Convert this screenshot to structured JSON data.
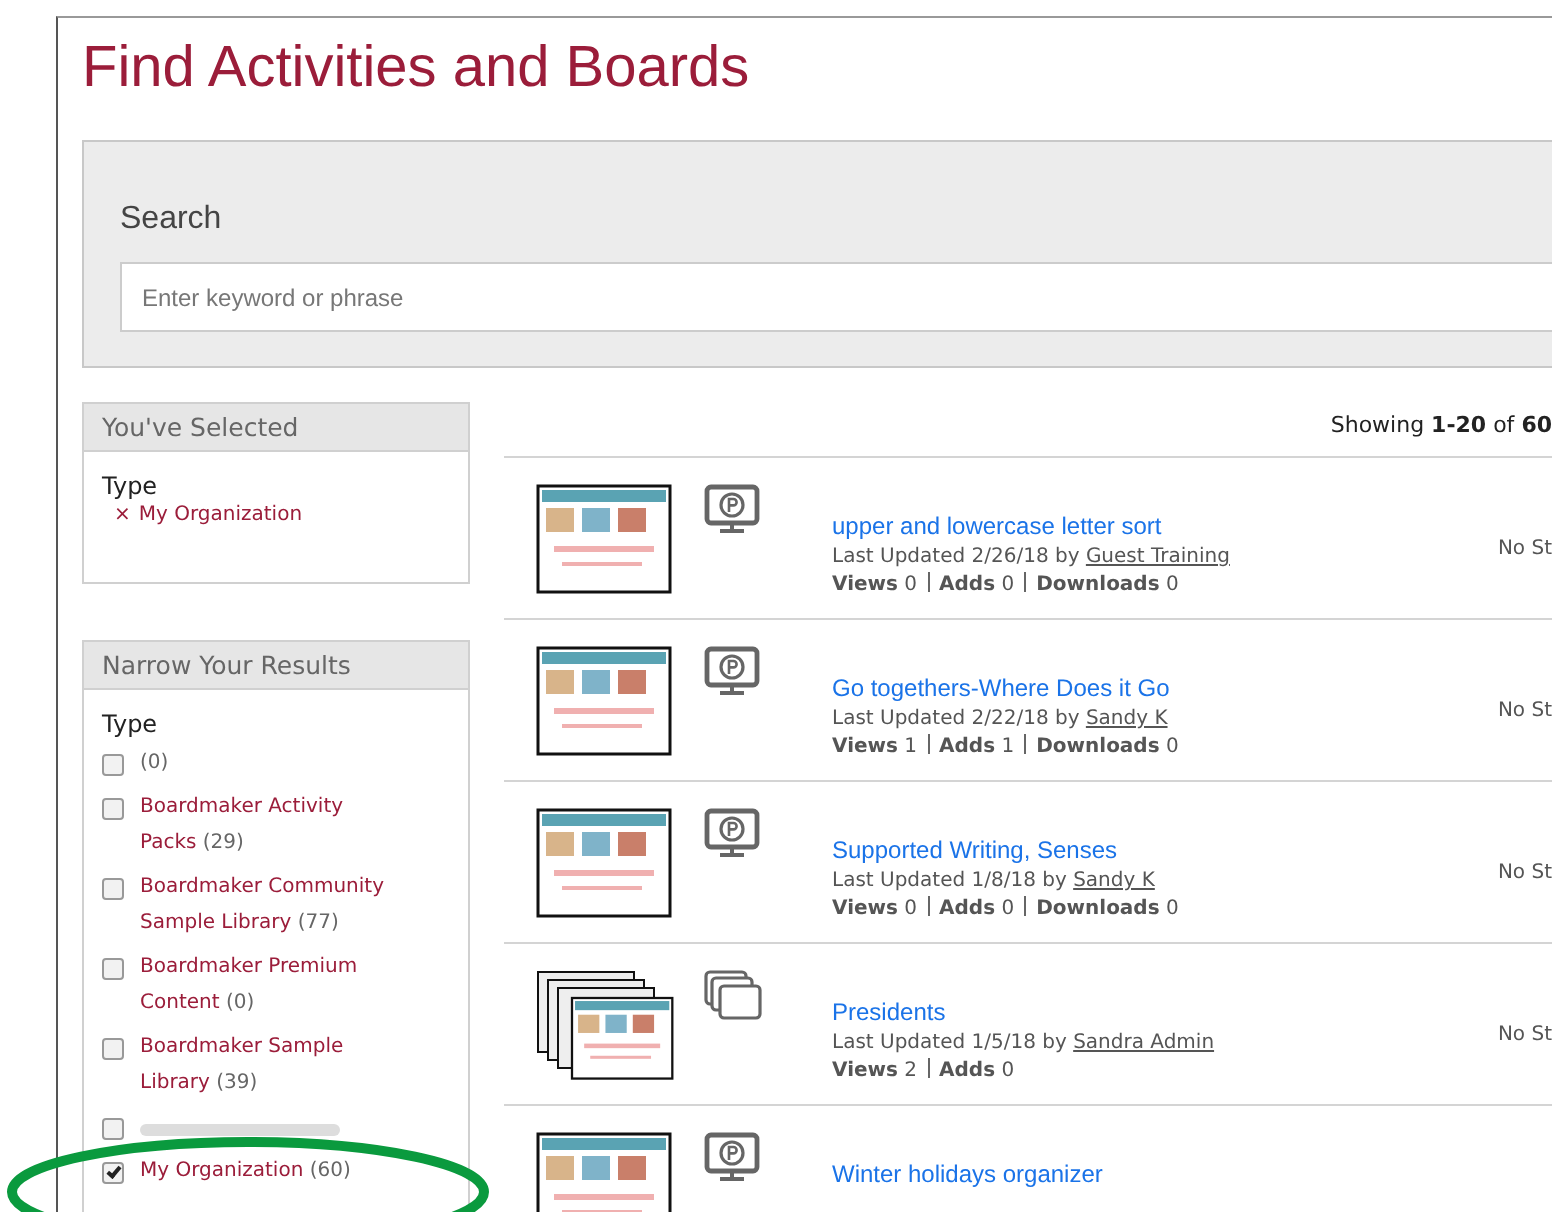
{
  "title": "Find Activities and Boards",
  "search": {
    "label": "Search",
    "placeholder": "Enter keyword or phrase"
  },
  "selected": {
    "heading": "You've Selected",
    "group": "Type",
    "items": [
      {
        "remove": "×",
        "label": "My Organization"
      }
    ]
  },
  "narrow": {
    "heading": "Narrow Your Results",
    "group": "Type",
    "options": [
      {
        "kind": "option",
        "count": "(0)",
        "checked": false
      },
      {
        "kind": "option",
        "label": "Boardmaker Activity Packs",
        "count": "(29)",
        "checked": false
      },
      {
        "kind": "option",
        "label": "Boardmaker Community Sample Library",
        "count": "(77)",
        "checked": false
      },
      {
        "kind": "option",
        "label": "Boardmaker Premium Content",
        "count": "(0)",
        "checked": false
      },
      {
        "kind": "option",
        "label": "Boardmaker Sample Library",
        "count": "(39)",
        "checked": false
      },
      {
        "kind": "covered",
        "checked": false
      },
      {
        "kind": "option",
        "label": "My Organization",
        "count": "(60)",
        "checked": true
      }
    ]
  },
  "summary": "Showing **1-20** of **60**",
  "results": [
    {
      "kind": "activity",
      "title": "upper and lowercase letter sort",
      "updated": "Last Updated 2/26/18 by",
      "author": "Guest Training",
      "stats": [
        {
          "label": "Views",
          "value": "0"
        },
        {
          "label": "Adds",
          "value": "0"
        },
        {
          "label": "Downloads",
          "value": "0"
        }
      ],
      "status": "No St"
    },
    {
      "kind": "activity",
      "title": "Go togethers-Where Does it Go",
      "updated": "Last Updated 2/22/18 by",
      "author": "Sandy K",
      "stats": [
        {
          "label": "Views",
          "value": "1"
        },
        {
          "label": "Adds",
          "value": "1"
        },
        {
          "label": "Downloads",
          "value": "0"
        }
      ],
      "status": "No St"
    },
    {
      "kind": "activity",
      "title": "Supported Writing, Senses",
      "updated": "Last Updated 1/8/18 by",
      "author": "Sandy K",
      "stats": [
        {
          "label": "Views",
          "value": "0"
        },
        {
          "label": "Adds",
          "value": "0"
        },
        {
          "label": "Downloads",
          "value": "0"
        }
      ],
      "status": "No St"
    },
    {
      "kind": "board",
      "title": "Presidents",
      "updated": "Last Updated 1/5/18 by",
      "author": "Sandra Admin",
      "stats": [
        {
          "label": "Views",
          "value": "2"
        },
        {
          "label": "Adds",
          "value": "0"
        }
      ],
      "status": "No St"
    },
    {
      "kind": "activity",
      "title": "Winter holidays organizer"
    }
  ]
}
